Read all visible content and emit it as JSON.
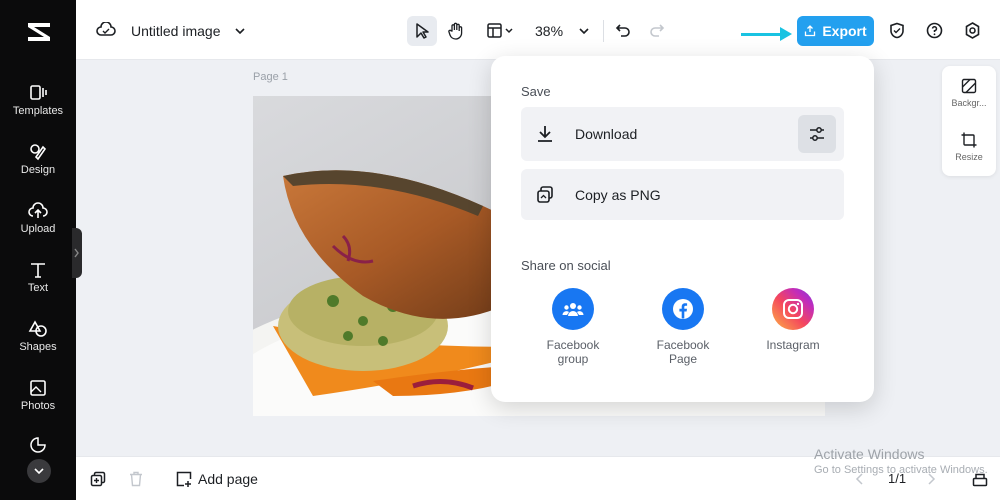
{
  "app": {
    "title": "Untitled image"
  },
  "sidebar": {
    "items": [
      {
        "label": "Templates",
        "icon": "templates-icon"
      },
      {
        "label": "Design",
        "icon": "design-icon"
      },
      {
        "label": "Upload",
        "icon": "upload-icon"
      },
      {
        "label": "Text",
        "icon": "text-icon"
      },
      {
        "label": "Shapes",
        "icon": "shapes-icon"
      },
      {
        "label": "Photos",
        "icon": "photos-icon"
      }
    ]
  },
  "toolbar": {
    "zoom": "38%",
    "export_label": "Export",
    "accent": "#23a0ef"
  },
  "canvas": {
    "page_label": "Page 1"
  },
  "right_panel": {
    "items": [
      {
        "label": "Backgr..."
      },
      {
        "label": "Resize"
      }
    ]
  },
  "export_menu": {
    "save_heading": "Save",
    "download_label": "Download",
    "copy_label": "Copy as PNG",
    "share_heading": "Share on social",
    "social": [
      {
        "label_line1": "Facebook",
        "label_line2": "group",
        "color": "#1877f2"
      },
      {
        "label_line1": "Facebook",
        "label_line2": "Page",
        "color": "#1877f2"
      },
      {
        "label_line1": "Instagram",
        "label_line2": "",
        "color": "#d6249f"
      }
    ]
  },
  "bottom": {
    "add_page_label": "Add page",
    "page_counter": "1/1"
  },
  "watermark": {
    "title": "Activate Windows",
    "subtitle": "Go to Settings to activate Windows."
  }
}
